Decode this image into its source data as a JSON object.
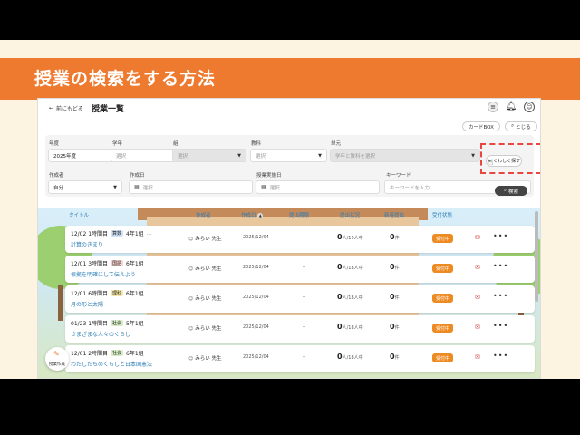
{
  "slide": {
    "title": "授業の検索をする方法",
    "colors": {
      "banner": "#ed7a2f",
      "highlight": "#e8473f",
      "accent": "#2f7fb8",
      "status": "#ee8a22"
    }
  },
  "header": {
    "back_label": "前にもどる",
    "page_title": "授業一覧",
    "icons": [
      "menu-icon",
      "bell-icon",
      "account-icon"
    ]
  },
  "actions": {
    "card_box": "カードBOX",
    "close": "とじる"
  },
  "filters": {
    "grade": {
      "label": "年度",
      "value": "2025年度"
    },
    "year": {
      "label": "学年",
      "value": "選択"
    },
    "class": {
      "label": "組",
      "value": "選択"
    },
    "subject": {
      "label": "教科",
      "value": "選択"
    },
    "unit": {
      "label": "単元",
      "placeholder": "学年と教科を選択"
    },
    "detail_button": "くわしく探す",
    "creator": {
      "label": "作成者",
      "value": "自分"
    },
    "created_date": {
      "label": "作成日",
      "value": "選択"
    },
    "lesson_date": {
      "label": "授業実施日",
      "value": "選択"
    },
    "keyword": {
      "label": "キーワード",
      "placeholder": "キーワードを入力"
    },
    "search_button": "検索"
  },
  "table": {
    "headers": {
      "title": "タイトル",
      "author": "作成者",
      "created": "作成日",
      "deadline": "提出期限",
      "status": "提出状況",
      "new": "新着提出",
      "reception": "受付状態"
    },
    "rows": [
      {
        "date": "12/02 1時間目",
        "subject": "算数",
        "subject_color": "#cfe3f7",
        "class": "4年1組",
        "extra": "…",
        "title": "計算のきまり",
        "author": "みらい 先生",
        "created": "2025/12/04",
        "deadline": "–",
        "status_num": "0",
        "status_suffix": "人/19人中",
        "new_num": "0",
        "new_suffix": "件",
        "badge": "受付中"
      },
      {
        "date": "12/01 3時間目",
        "subject": "国語",
        "subject_color": "#f7d2cf",
        "class": "6年1組",
        "extra": "",
        "title": "根拠を明確にして伝えよう",
        "author": "みらい 先生",
        "created": "2025/12/04",
        "deadline": "–",
        "status_num": "0",
        "status_suffix": "人/18人中",
        "new_num": "0",
        "new_suffix": "件",
        "badge": "受付中"
      },
      {
        "date": "12/01 6時間目",
        "subject": "理科",
        "subject_color": "#f3e6a6",
        "class": "6年1組",
        "extra": "",
        "title": "月の形と太陽",
        "author": "みらい 先生",
        "created": "2025/12/04",
        "deadline": "–",
        "status_num": "0",
        "status_suffix": "人/18人中",
        "new_num": "0",
        "new_suffix": "件",
        "badge": "受付中"
      },
      {
        "date": "01/23 1時間目",
        "subject": "社会",
        "subject_color": "#d6ecc6",
        "class": "5年1組",
        "extra": "",
        "title": "さまざまな人々のくらし",
        "author": "みらい 先生",
        "created": "2025/12/04",
        "deadline": "–",
        "status_num": "0",
        "status_suffix": "人/18人中",
        "new_num": "0",
        "new_suffix": "件",
        "badge": "受付中"
      },
      {
        "date": "12/01 2時間目",
        "subject": "社会",
        "subject_color": "#d6ecc6",
        "class": "6年1組",
        "extra": "",
        "title": "わたしたちのくらしと日本国憲法",
        "author": "みらい 先生",
        "created": "2025/12/04",
        "deadline": "–",
        "status_num": "0",
        "status_suffix": "人/18人中",
        "new_num": "0",
        "new_suffix": "件",
        "badge": "受付中"
      }
    ]
  },
  "fab": {
    "label": "授業作成"
  }
}
